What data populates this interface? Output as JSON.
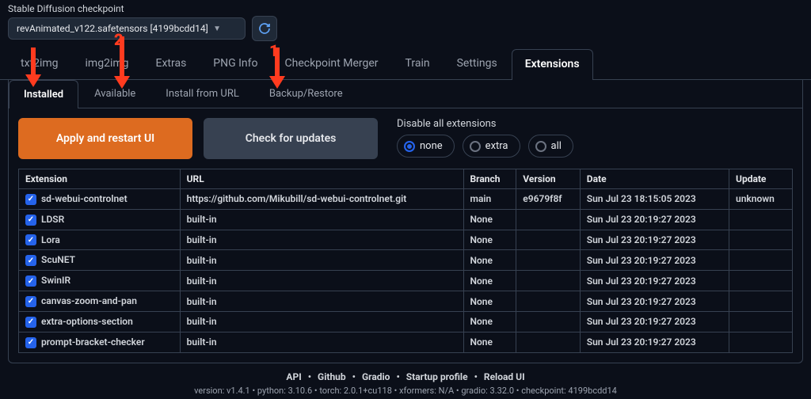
{
  "checkpoint": {
    "label": "Stable Diffusion checkpoint",
    "value": "revAnimated_v122.safetensors [4199bcdd14]"
  },
  "main_tabs": [
    "txt2img",
    "img2img",
    "Extras",
    "PNG Info",
    "Checkpoint Merger",
    "Train",
    "Settings",
    "Extensions"
  ],
  "main_active": 7,
  "sub_tabs": [
    "Installed",
    "Available",
    "Install from URL",
    "Backup/Restore"
  ],
  "sub_active": 0,
  "buttons": {
    "apply": "Apply and restart UI",
    "check": "Check for updates"
  },
  "disable": {
    "label": "Disable all extensions",
    "options": [
      "none",
      "extra",
      "all"
    ],
    "selected": 0
  },
  "table": {
    "headers": [
      "Extension",
      "URL",
      "Branch",
      "Version",
      "Date",
      "Update"
    ],
    "rows": [
      {
        "checked": true,
        "name": "sd-webui-controlnet",
        "url": "https://github.com/Mikubill/sd-webui-controlnet.git",
        "branch": "main",
        "version": "e9679f8f",
        "date": "Sun Jul 23 18:15:05 2023",
        "update": "unknown"
      },
      {
        "checked": true,
        "name": "LDSR",
        "url": "built-in",
        "branch": "None",
        "version": "",
        "date": "Sun Jul 23 20:19:27 2023",
        "update": ""
      },
      {
        "checked": true,
        "name": "Lora",
        "url": "built-in",
        "branch": "None",
        "version": "",
        "date": "Sun Jul 23 20:19:27 2023",
        "update": ""
      },
      {
        "checked": true,
        "name": "ScuNET",
        "url": "built-in",
        "branch": "None",
        "version": "",
        "date": "Sun Jul 23 20:19:27 2023",
        "update": ""
      },
      {
        "checked": true,
        "name": "SwinIR",
        "url": "built-in",
        "branch": "None",
        "version": "",
        "date": "Sun Jul 23 20:19:27 2023",
        "update": ""
      },
      {
        "checked": true,
        "name": "canvas-zoom-and-pan",
        "url": "built-in",
        "branch": "None",
        "version": "",
        "date": "Sun Jul 23 20:19:27 2023",
        "update": ""
      },
      {
        "checked": true,
        "name": "extra-options-section",
        "url": "built-in",
        "branch": "None",
        "version": "",
        "date": "Sun Jul 23 20:19:27 2023",
        "update": ""
      },
      {
        "checked": true,
        "name": "prompt-bracket-checker",
        "url": "built-in",
        "branch": "None",
        "version": "",
        "date": "Sun Jul 23 20:19:27 2023",
        "update": ""
      }
    ]
  },
  "footer": {
    "links": [
      "API",
      "Github",
      "Gradio",
      "Startup profile",
      "Reload UI"
    ],
    "meta": "version: v1.4.1  •  python: 3.10.6  •  torch: 2.0.1+cu118  •  xformers: N/A  •  gradio: 3.32.0  •  checkpoint: 4199bcdd14"
  },
  "annotations": {
    "arrow1": "1",
    "arrow2": "2"
  }
}
